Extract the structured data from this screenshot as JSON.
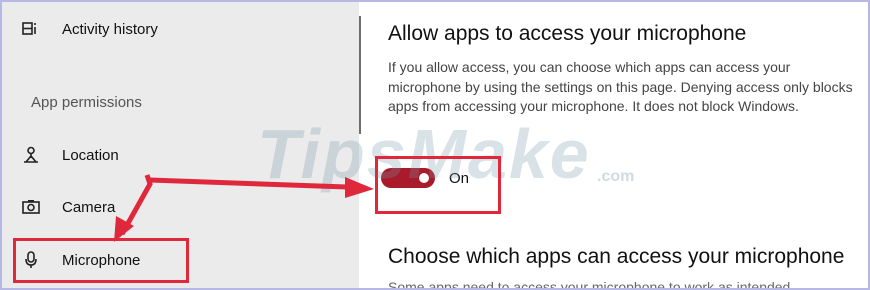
{
  "sidebar": {
    "activity_history": "Activity history",
    "section_header": "App permissions",
    "location": "Location",
    "camera": "Camera",
    "microphone": "Microphone"
  },
  "main": {
    "heading": "Allow apps to access your microphone",
    "description": "If you allow access, you can choose which apps can access your microphone by using the settings on this page. Denying access only blocks apps from accessing your microphone. It does not block Windows.",
    "toggle_label": "On",
    "toggle_state": "on",
    "subheading": "Choose which apps can access your microphone",
    "cut_text": "Some apps need to access your microphone to work as intended"
  },
  "watermark": {
    "text": "TipsMake",
    "suffix": ".com"
  },
  "colors": {
    "highlight": "#e0283d",
    "toggle_on": "#a91a2a",
    "sidebar_bg": "#ebebeb"
  }
}
